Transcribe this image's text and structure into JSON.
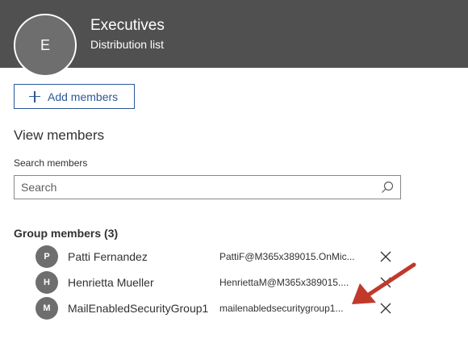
{
  "header": {
    "avatar_initial": "E",
    "title": "Executives",
    "subtitle": "Distribution list"
  },
  "toolbar": {
    "add_members_label": "Add members"
  },
  "view_members": {
    "title": "View members",
    "search_label": "Search members",
    "search_placeholder": "Search",
    "search_value": ""
  },
  "group_members": {
    "title": "Group members (3)",
    "members": [
      {
        "initial": "P",
        "name": "Patti Fernandez",
        "email": "PattiF@M365x389015.OnMic..."
      },
      {
        "initial": "H",
        "name": "Henrietta Mueller",
        "email": "HenriettaM@M365x389015...."
      },
      {
        "initial": "M",
        "name": "MailEnabledSecurityGroup1",
        "email": "mailenabledsecuritygroup1..."
      }
    ]
  },
  "colors": {
    "header_bg": "#505050",
    "accent": "#2b579a",
    "avatar_bg": "#6e6e6e",
    "annotation_arrow": "#c0392b"
  },
  "icons": [
    "plus-icon",
    "search-icon",
    "close-icon"
  ]
}
